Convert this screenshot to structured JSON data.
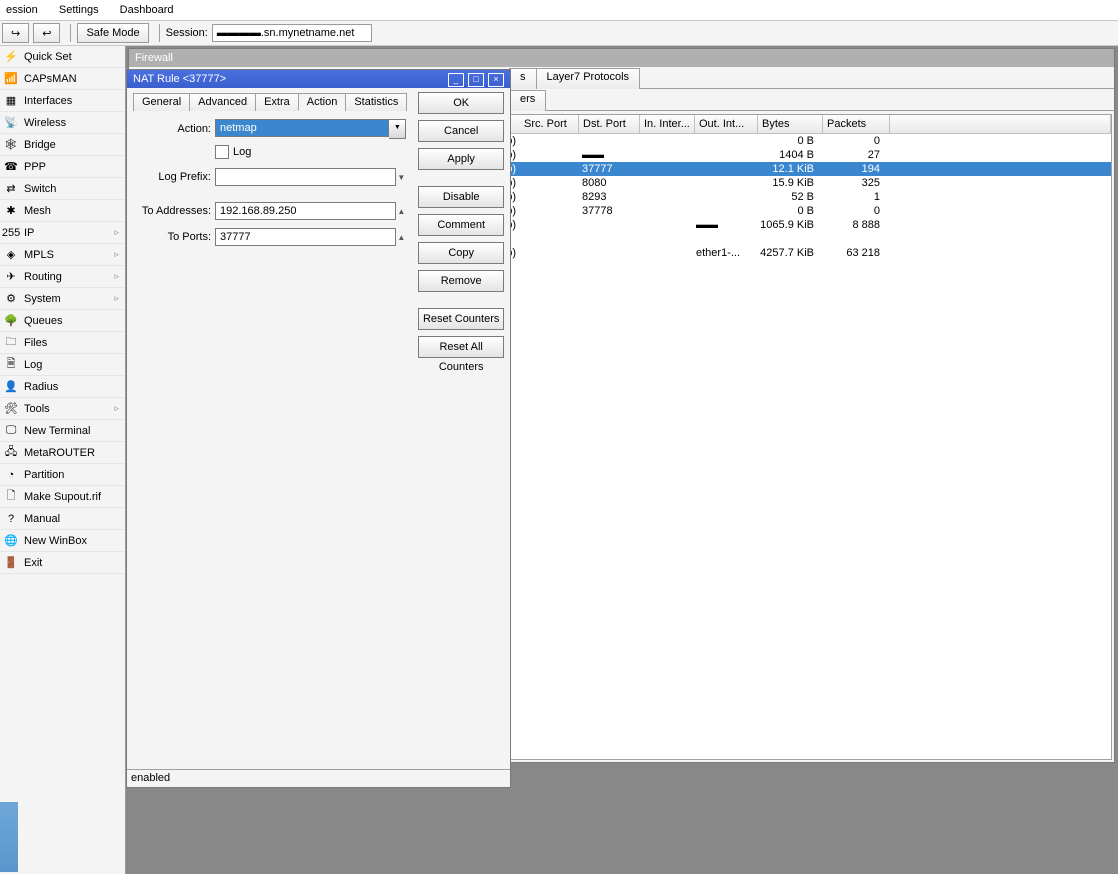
{
  "menubar": [
    "ession",
    "Settings",
    "Dashboard"
  ],
  "toolbar": {
    "safe_mode": "Safe Mode",
    "session_label": "Session:",
    "session_host": ".sn.mynetname.net",
    "undo_icon": "↪",
    "redo_icon": "↩"
  },
  "sidebar": [
    {
      "icon": "⚡",
      "label": "Quick Set"
    },
    {
      "icon": "📶",
      "label": "CAPsMAN"
    },
    {
      "icon": "▦",
      "label": "Interfaces"
    },
    {
      "icon": "📡",
      "label": "Wireless"
    },
    {
      "icon": "🕸",
      "label": "Bridge"
    },
    {
      "icon": "☎",
      "label": "PPP"
    },
    {
      "icon": "⇄",
      "label": "Switch"
    },
    {
      "icon": "✱",
      "label": "Mesh"
    },
    {
      "icon": "255",
      "label": "IP",
      "sub": "▹"
    },
    {
      "icon": "◈",
      "label": "MPLS",
      "sub": "▹"
    },
    {
      "icon": "✈",
      "label": "Routing",
      "sub": "▹"
    },
    {
      "icon": "⚙",
      "label": "System",
      "sub": "▹"
    },
    {
      "icon": "🌳",
      "label": "Queues"
    },
    {
      "icon": "🗀",
      "label": "Files"
    },
    {
      "icon": "🗎",
      "label": "Log"
    },
    {
      "icon": "👤",
      "label": "Radius"
    },
    {
      "icon": "🛠",
      "label": "Tools",
      "sub": "▹"
    },
    {
      "icon": "🖵",
      "label": "New Terminal"
    },
    {
      "icon": "🖧",
      "label": "MetaROUTER"
    },
    {
      "icon": "◔",
      "label": "Partition"
    },
    {
      "icon": "🗋",
      "label": "Make Supout.rif"
    },
    {
      "icon": "?",
      "label": "Manual"
    },
    {
      "icon": "🌐",
      "label": "New WinBox"
    },
    {
      "icon": "🚪",
      "label": "Exit"
    }
  ],
  "firewall": {
    "title": "Firewall",
    "tabs_top": [
      "s",
      "Layer7 Protocols"
    ],
    "tabs_sub": [
      "ers"
    ],
    "columns": [
      "Src. Port",
      "Dst. Port",
      "In. Inter...",
      "Out. Int...",
      "Bytes",
      "Packets"
    ],
    "rows": [
      {
        "src": "",
        "dst": "",
        "ini": "",
        "out": "",
        "bytes": "0 B",
        "pkts": "0"
      },
      {
        "src": "",
        "dst": "▬▬",
        "ini": "",
        "out": "",
        "bytes": "1404 B",
        "pkts": "27"
      },
      {
        "src": "",
        "dst": "37777",
        "ini": "",
        "out": "",
        "bytes": "12.1 KiB",
        "pkts": "194",
        "sel": true
      },
      {
        "src": "",
        "dst": "8080",
        "ini": "",
        "out": "",
        "bytes": "15.9 KiB",
        "pkts": "325"
      },
      {
        "src": "",
        "dst": "8293",
        "ini": "",
        "out": "",
        "bytes": "52 B",
        "pkts": "1"
      },
      {
        "src": "",
        "dst": "37778",
        "ini": "",
        "out": "",
        "bytes": "0 B",
        "pkts": "0"
      },
      {
        "src": "",
        "dst": "",
        "ini": "",
        "out": "▬▬",
        "bytes": "1065.9 KiB",
        "pkts": "8 888"
      },
      {
        "src": "",
        "dst": "",
        "ini": "",
        "out": "",
        "bytes": "",
        "pkts": ""
      },
      {
        "src": "",
        "dst": "",
        "ini": "",
        "out": "ether1-...",
        "bytes": "4257.7 KiB",
        "pkts": "63 218"
      }
    ]
  },
  "nat": {
    "title": "NAT Rule <37777>",
    "tabs": [
      "General",
      "Advanced",
      "Extra",
      "Action",
      "Statistics"
    ],
    "active_tab": "Action",
    "fields": {
      "action_label": "Action:",
      "action_value": "netmap",
      "log_label": "Log",
      "logprefix_label": "Log Prefix:",
      "logprefix_value": "",
      "toaddr_label": "To Addresses:",
      "toaddr_value": "192.168.89.250",
      "toports_label": "To Ports:",
      "toports_value": "37777"
    },
    "buttons": [
      "OK",
      "Cancel",
      "Apply",
      "Disable",
      "Comment",
      "Copy",
      "Remove",
      "Reset Counters",
      "Reset All Counters"
    ],
    "status": "enabled"
  }
}
